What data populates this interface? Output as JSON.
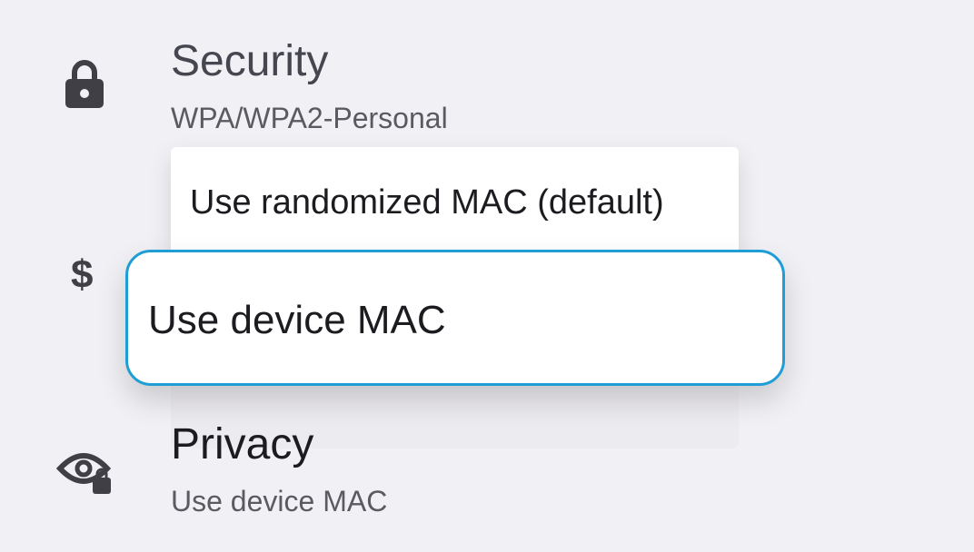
{
  "security": {
    "title": "Security",
    "summary": "WPA/WPA2-Personal",
    "icon": "lock-icon"
  },
  "metered": {
    "icon": "dollar-icon"
  },
  "mac_menu": {
    "options": [
      {
        "label": "Use randomized MAC (default)",
        "selected": false
      },
      {
        "label": "Use device MAC",
        "selected": true
      }
    ],
    "accent_color": "#1f9ed6"
  },
  "privacy": {
    "title": "Privacy",
    "summary": "Use device MAC",
    "icon": "eye-lock-icon"
  }
}
